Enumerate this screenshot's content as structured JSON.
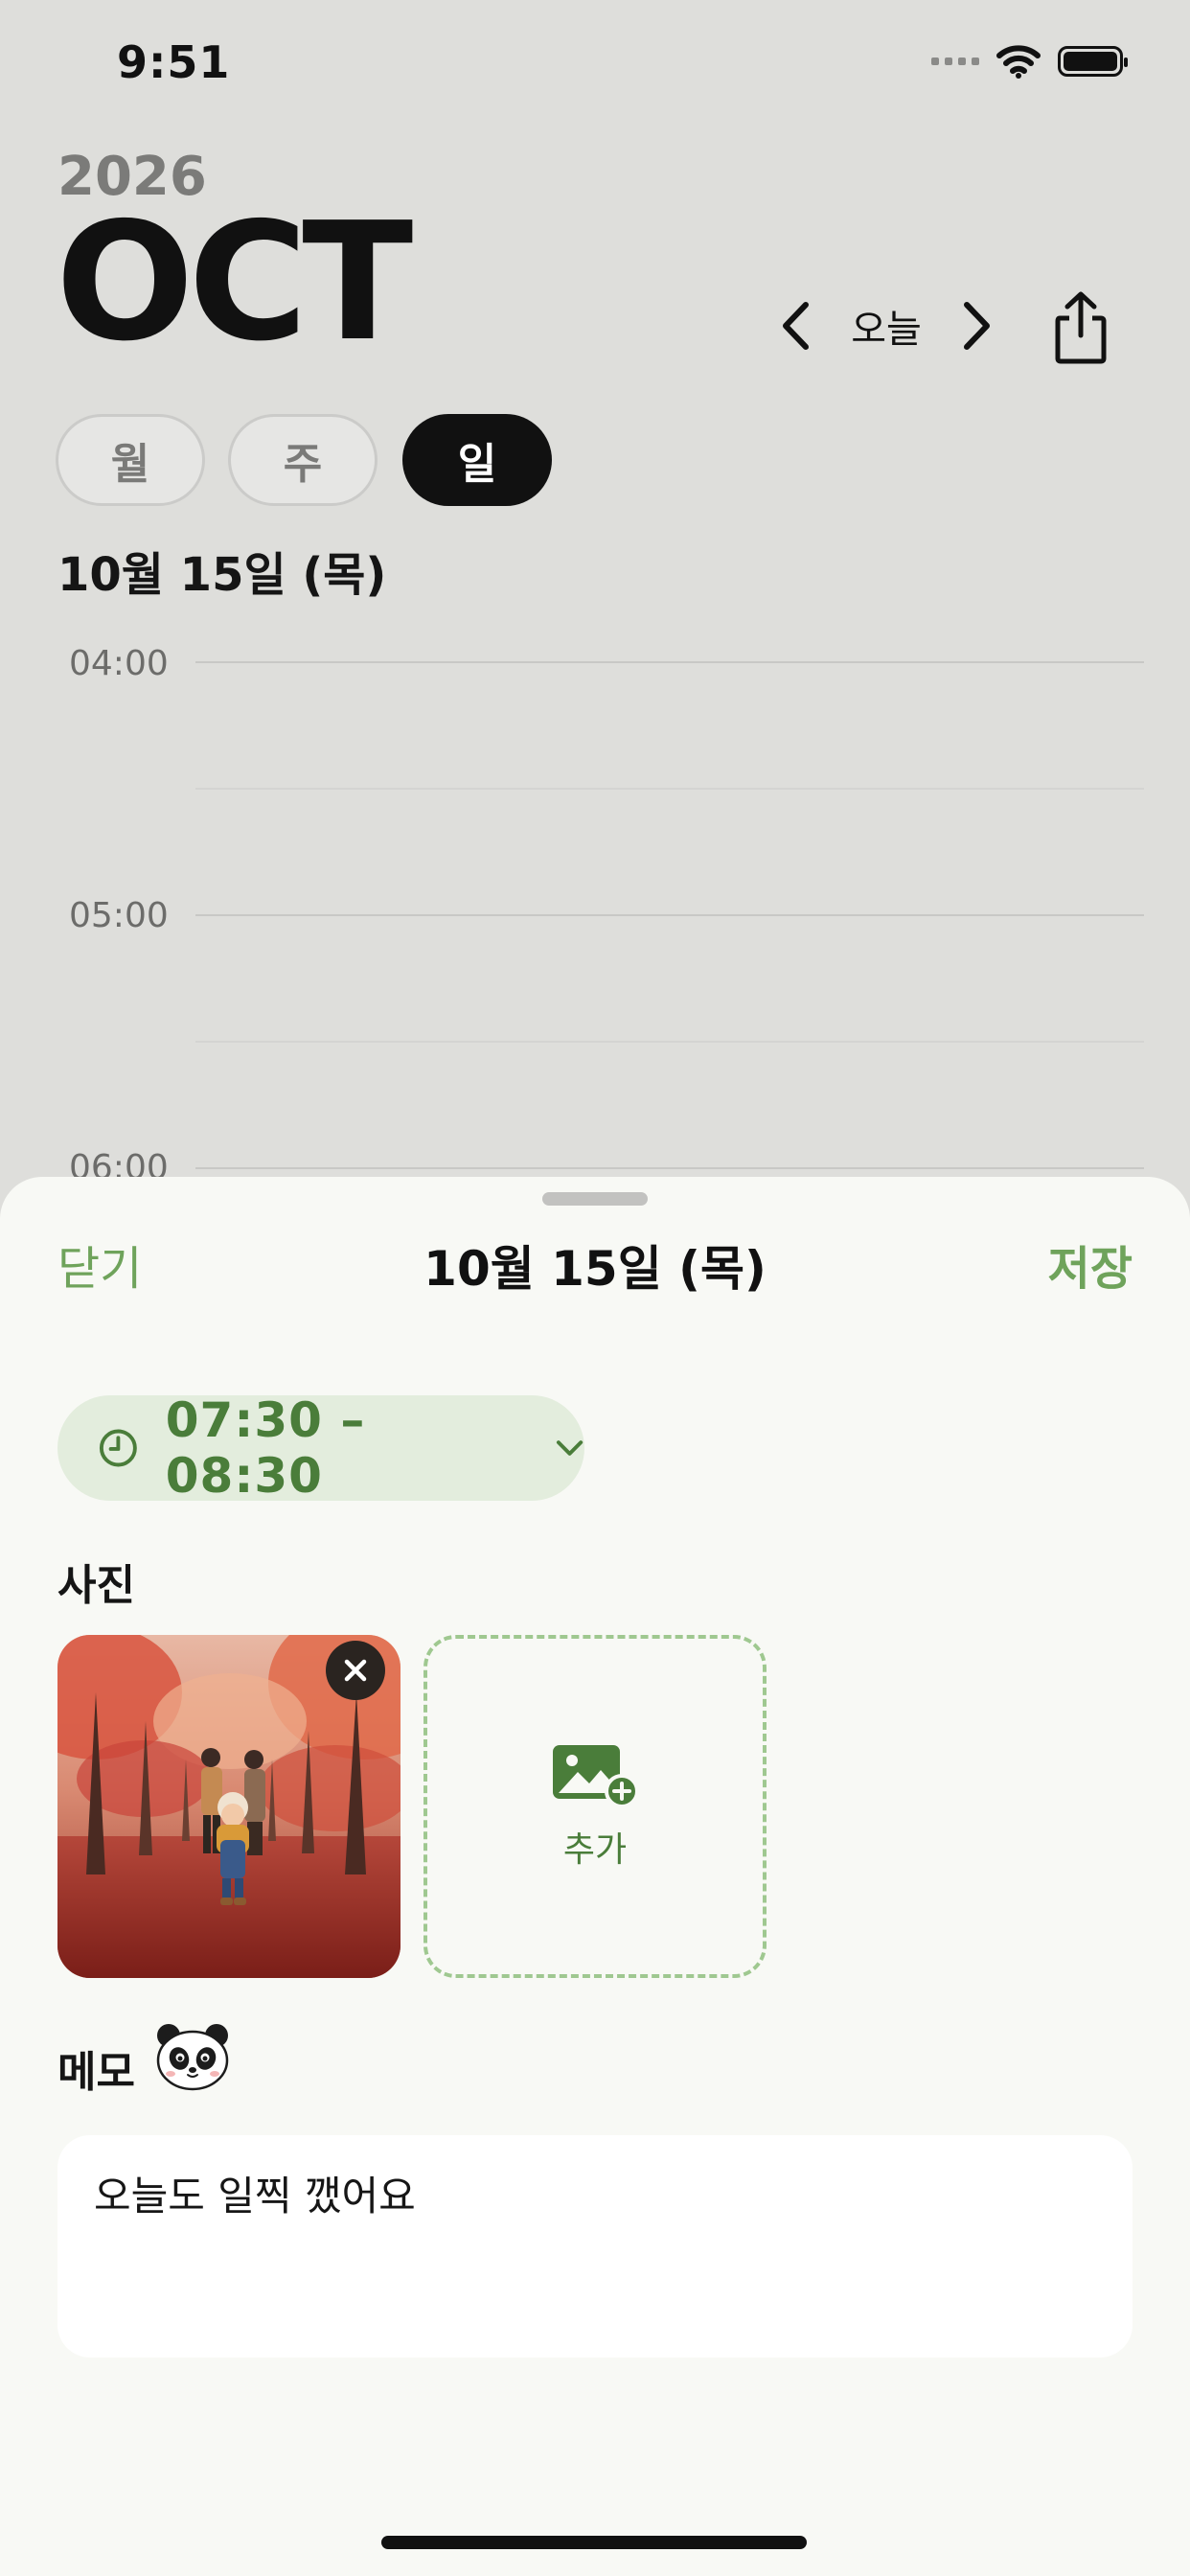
{
  "status_bar": {
    "time": "9:51"
  },
  "header": {
    "year": "2026",
    "month": "OCT",
    "today_label": "오늘"
  },
  "view_modes": {
    "items": [
      {
        "label": "월",
        "selected": false
      },
      {
        "label": "주",
        "selected": false
      },
      {
        "label": "일",
        "selected": true
      }
    ]
  },
  "day_view": {
    "date_title": "10월 15일 (목)",
    "hours": [
      "04:00",
      "05:00",
      "06:00"
    ]
  },
  "sheet": {
    "close_label": "닫기",
    "title": "10월 15일 (목)",
    "save_label": "저장",
    "time_range": "07:30 – 08:30",
    "photos_label": "사진",
    "add_photo_label": "추가",
    "memo_label": "메모",
    "memo_text": "오늘도 일찍 깼어요"
  },
  "colors": {
    "accent_green": "#6fa35b",
    "dark_green": "#4a7d3a",
    "pill_bg": "#e3eddd",
    "background": "#dededb",
    "sheet_bg": "#f8f9f5"
  },
  "icons": {
    "wifi": "wifi-icon",
    "battery": "battery-icon",
    "prev": "chevron-left-icon",
    "next": "chevron-right-icon",
    "share": "share-icon",
    "clock": "clock-icon",
    "dropdown": "chevron-down-icon",
    "remove": "close-icon",
    "add_photo": "image-add-icon",
    "memo_sticker": "panda-icon"
  }
}
